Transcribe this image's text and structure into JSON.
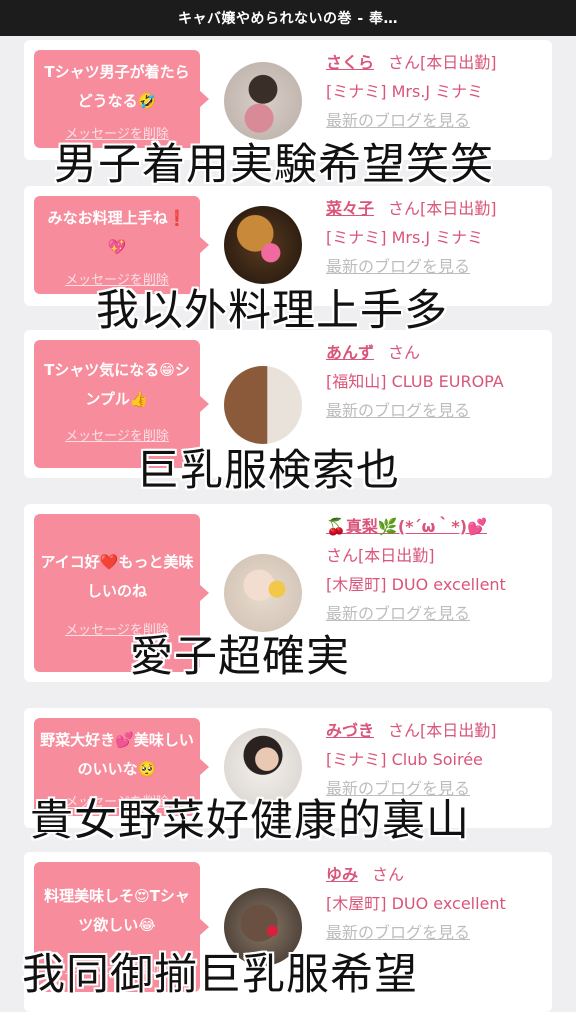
{
  "header": {
    "title": "キャバ嬢やめられないの巻 - 奉…"
  },
  "cards": [
    {
      "message": "Tシャツ男子が着たらどうなる🤣",
      "delete_label": "メッセージを削除",
      "name": "さくら",
      "suffix": "さん[本日出勤]",
      "shop": "[ミナミ] Mrs.J ミナミ",
      "blog_label": "最新のブログを見る",
      "overlay": "男子着用実験希望笑笑"
    },
    {
      "message": "みなお料理上手ね❗💖",
      "delete_label": "メッセージを削除",
      "name": "菜々子",
      "suffix": "さん[本日出勤]",
      "shop": "[ミナミ] Mrs.J ミナミ",
      "blog_label": "最新のブログを見る",
      "overlay": "我以外料理上手多"
    },
    {
      "message": "Tシャツ気になる😁シンプル👍",
      "delete_label": "メッセージを削除",
      "name": "あんず",
      "suffix": "さん",
      "shop": "[福知山] CLUB EUROPA",
      "blog_label": "最新のブログを見る",
      "overlay": "巨乳服検索也"
    },
    {
      "message": "アイコ好❤️もっと美味しいのね",
      "delete_label": "メッセージを削除",
      "name": "🍒真梨🌿(*´ω｀*)💕",
      "suffix": "さん[本日出勤]",
      "shop": "[木屋町] DUO excellent",
      "blog_label": "最新のブログを見る",
      "overlay": "愛子超確実"
    },
    {
      "message": "野菜大好き💕美味しいのいいな🥺",
      "delete_label": "メッセージを削除",
      "name": "みづき",
      "suffix": "さん[本日出勤]",
      "shop": "[ミナミ] Club Soirée",
      "blog_label": "最新のブログを見る",
      "overlay": "貴女野菜好健康的裏山"
    },
    {
      "message": "料理美味しそ😍Tシャツ欲しい😂",
      "delete_label": "メッセージを削除",
      "name": "ゆみ",
      "suffix": "さん",
      "shop": "[木屋町] DUO excellent",
      "blog_label": "最新のブログを見る",
      "overlay": "我同御揃巨乳服希望"
    }
  ]
}
